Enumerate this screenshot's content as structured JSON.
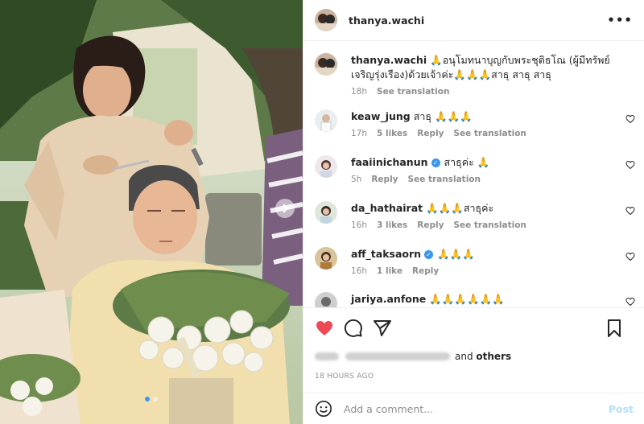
{
  "post": {
    "username": "thanya.wachi",
    "more_label": "•••",
    "carousel": {
      "count": 2,
      "active": 1
    }
  },
  "caption": {
    "username": "thanya.wachi",
    "text": "🙏อนุโมทนาบุญกับพระชุติธโณ (ผู้มีทรัพย์ เจริญรุ่งเรือง)ด้วยเจ้าค่ะ🙏🙏🙏สาธุ สาธุ สาธุ",
    "time": "18h",
    "see_translation": "See translation"
  },
  "comments": [
    {
      "username": "keaw_jung",
      "verified": false,
      "text": "สาธุ 🙏🙏🙏",
      "time": "17h",
      "likes": "5 likes",
      "reply": "Reply",
      "see_translation": "See translation"
    },
    {
      "username": "faaiinichanun",
      "verified": true,
      "text": "สาธุค่ะ 🙏",
      "time": "5h",
      "likes": "",
      "reply": "Reply",
      "see_translation": "See translation"
    },
    {
      "username": "da_hathairat",
      "verified": false,
      "text": "🙏🙏🙏สาธุค่ะ",
      "time": "16h",
      "likes": "3 likes",
      "reply": "Reply",
      "see_translation": "See translation"
    },
    {
      "username": "aff_taksaorn",
      "verified": true,
      "text": "🙏🙏🙏",
      "time": "16h",
      "likes": "1 like",
      "reply": "Reply",
      "see_translation": ""
    },
    {
      "username": "jariya.anfone",
      "verified": false,
      "text": "🙏🙏🙏🙏🙏🙏",
      "time": "",
      "likes": "",
      "reply": "",
      "see_translation": ""
    }
  ],
  "likes": {
    "others_prefix": "and",
    "others": "others"
  },
  "timestamp": "18 HOURS AGO",
  "add_comment": {
    "placeholder": "Add a comment...",
    "post_label": "Post"
  },
  "colors": {
    "like_red": "#ed4956",
    "verified_blue": "#3897f0",
    "post_disabled": "#b2dffc",
    "muted": "#8e8e8e"
  },
  "icons": [
    "heart-icon",
    "comment-icon",
    "share-icon",
    "bookmark-icon",
    "emoji-icon",
    "more-icon",
    "carousel-next-icon"
  ]
}
